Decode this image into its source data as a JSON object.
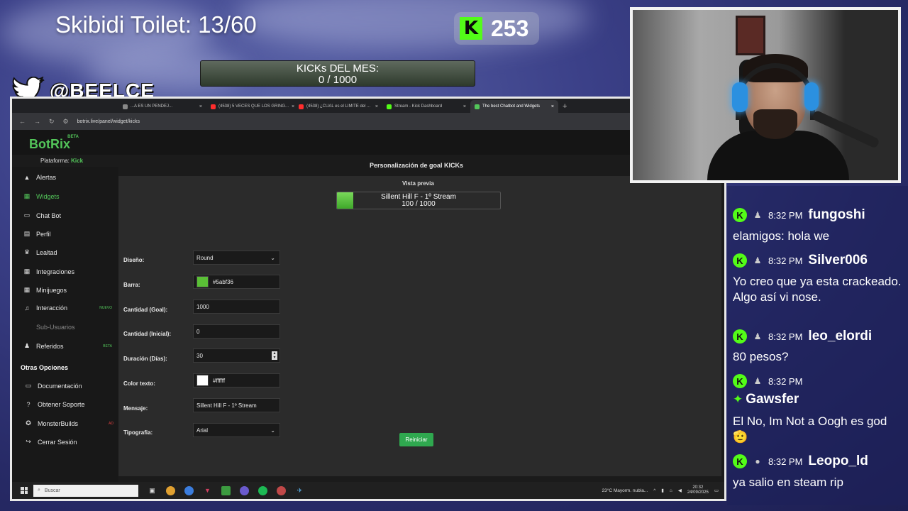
{
  "overlay": {
    "counter_title": "Skibidi Toilet: 13/60",
    "kick_logo": "K",
    "kick_count": "253",
    "goal_title": "KICKs DEL MES:",
    "goal_value": "0 / 1000",
    "twitter_handle": "@BEELCE_",
    "icons": [
      "twitter-bird-icon",
      "kick-logo-icon"
    ]
  },
  "browser": {
    "tabs": [
      {
        "label": "...A ES UN PENDEJ...",
        "favicon_color": "#888888"
      },
      {
        "label": "(4538) 5 VECES QUE LOS GRING...",
        "favicon_color": "#ff2d2d"
      },
      {
        "label": "(4538) ¿CUAL es el LIMITE del ...",
        "favicon_color": "#ff2d2d"
      },
      {
        "label": "Stream - Kick Dashboard",
        "favicon_color": "#53fc18"
      },
      {
        "label": "The best Chatbot and Widgets",
        "favicon_color": "#53c65a"
      }
    ],
    "new_tab_symbol": "+",
    "url": "botrix.live/panel/widget/kicks"
  },
  "app": {
    "logo": "BotRix",
    "logo_badge": "BETA",
    "platform_label": "Plataforma:",
    "platform_value": "Kick",
    "sidebar": [
      {
        "label": "Alertas",
        "icon": "▲"
      },
      {
        "label": "Widgets",
        "icon": "▦",
        "active": true
      },
      {
        "label": "Chat Bot",
        "icon": "▭"
      },
      {
        "label": "Perfil",
        "icon": "▤"
      },
      {
        "label": "Lealtad",
        "icon": "♛"
      },
      {
        "label": "Integraciones",
        "icon": "▦"
      },
      {
        "label": "Minijuegos",
        "icon": "▦"
      },
      {
        "label": "Interacción",
        "icon": "♫",
        "badge": "NUEVO"
      },
      {
        "label": "Sub-Usuarios",
        "icon": "",
        "dim": true
      },
      {
        "label": "Referidos",
        "icon": "♟",
        "badge": "BETA"
      }
    ],
    "other_heading": "Otras Opciones",
    "other_items": [
      {
        "label": "Documentación",
        "icon": "▭"
      },
      {
        "label": "Obtener Soporte",
        "icon": "?"
      },
      {
        "label": "MonsterBuilds",
        "icon": "✪",
        "badge": "AD"
      },
      {
        "label": "Cerrar Sesión",
        "icon": "↪"
      }
    ],
    "panel_title": "Personalización de goal KICKs",
    "preview_label": "Vista previa",
    "preview_text": "Sillent Hill F - 1º Stream",
    "preview_value": "100 / 1000",
    "preview_progress": 0.1,
    "preview_color": "#5abf36",
    "fields": [
      {
        "label": "Diseño:",
        "value": "Round",
        "kind": "select"
      },
      {
        "label": "Barra:",
        "value": "#5abf36",
        "kind": "color",
        "color": "#5abf36"
      },
      {
        "label": "Cantidad (Goal):",
        "value": "1000",
        "kind": "text"
      },
      {
        "label": "Cantidad (Inicial):",
        "value": "0",
        "kind": "text"
      },
      {
        "label": "Duración (Días):",
        "value": "30",
        "kind": "number"
      },
      {
        "label": "Color texto:",
        "value": "#ffffff",
        "kind": "color",
        "color": "#ffffff"
      },
      {
        "label": "Mensaje:",
        "value": "Sillent Hill F - 1º Stream",
        "kind": "text"
      },
      {
        "label": "Tipografia:",
        "value": "Arial",
        "kind": "select"
      }
    ],
    "reset_button": "Reiniciar"
  },
  "taskbar": {
    "search_placeholder": "Buscar",
    "weather": "23°C  Mayorm. nubla...",
    "time": "20:32",
    "date": "24/09/2025"
  },
  "chat": {
    "messages": [
      {
        "time": "8:32 PM",
        "user": "fungoshi",
        "text": "elamigos: hola we"
      },
      {
        "time": "8:32 PM",
        "user": "Silver006",
        "text": "Yo creo que ya esta crackeado. Algo así vi nose."
      },
      {
        "time": "8:32 PM",
        "user": "leo_elordi",
        "text": "80 pesos?"
      },
      {
        "time": "8:32 PM",
        "user": "Gawsfer",
        "text": "El No, Im Not a Oogh es god 🫡"
      },
      {
        "time": "8:32 PM",
        "user": "Leopo_ld",
        "text": "ya salio en steam rip"
      }
    ]
  }
}
